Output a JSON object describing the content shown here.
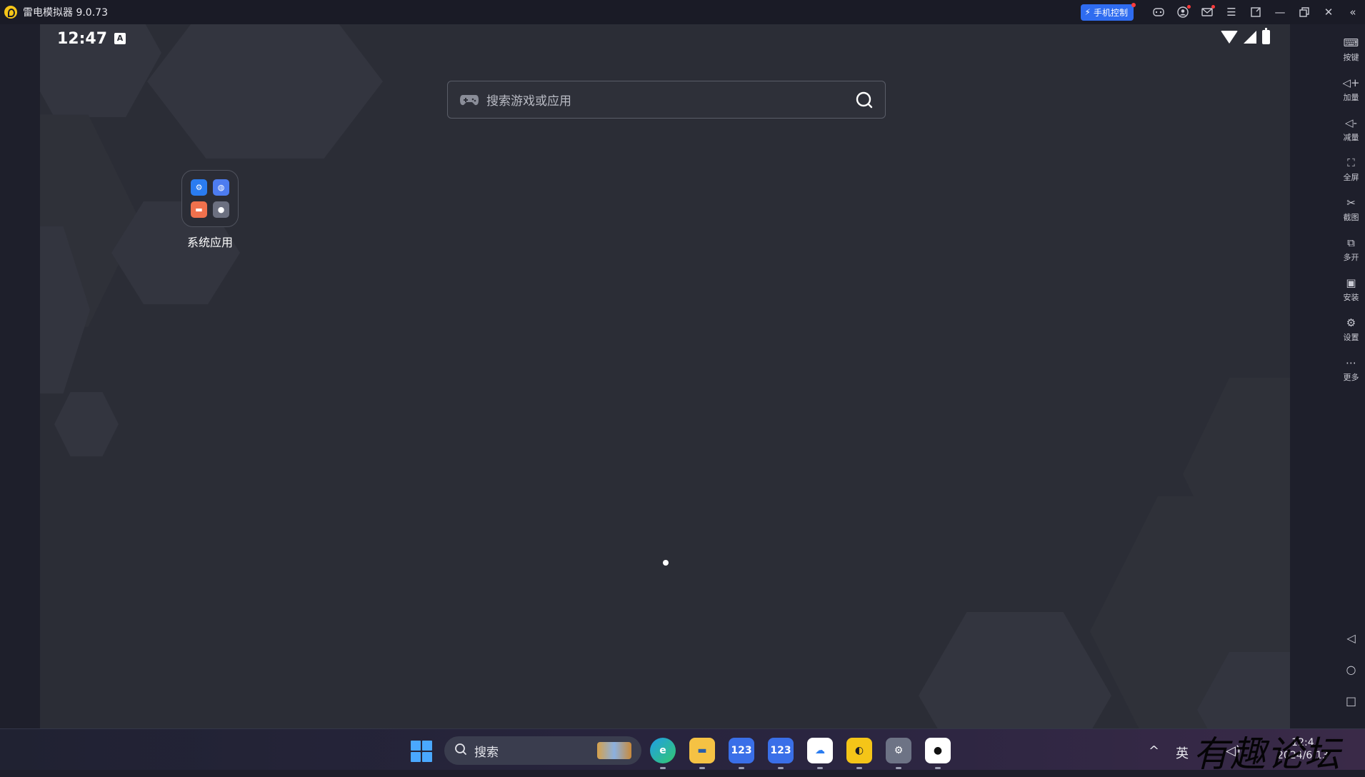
{
  "window": {
    "title": "雷电模拟器 9.0.73",
    "phone_control_label": "手机控制"
  },
  "status_bar": {
    "time": "12:47",
    "notification_letter": "A"
  },
  "search": {
    "placeholder": "搜索游戏或应用"
  },
  "folder": {
    "label": "系统应用"
  },
  "sidebar": {
    "items": [
      {
        "label": "按键",
        "icon": "keyboard-icon"
      },
      {
        "label": "加量",
        "icon": "volume-up-icon"
      },
      {
        "label": "减量",
        "icon": "volume-down-icon"
      },
      {
        "label": "全屏",
        "icon": "fullscreen-icon"
      },
      {
        "label": "截图",
        "icon": "scissors-icon"
      },
      {
        "label": "多开",
        "icon": "multi-window-icon"
      },
      {
        "label": "安装",
        "icon": "apk-icon"
      },
      {
        "label": "设置",
        "icon": "gear-icon"
      },
      {
        "label": "更多",
        "icon": "more-icon"
      }
    ]
  },
  "taskbar": {
    "search_placeholder": "搜索",
    "apps": [
      {
        "name": "edge",
        "icon": "edge-icon",
        "color": "#1f9ee8"
      },
      {
        "name": "file-explorer",
        "icon": "folder-icon",
        "color": "#f5c244"
      },
      {
        "name": "123pan-1",
        "icon": "123-icon",
        "glyph": "123",
        "color": "#3a6fe8"
      },
      {
        "name": "123pan-2",
        "icon": "123-icon",
        "glyph": "123",
        "color": "#3a6fe8"
      },
      {
        "name": "cloud-app",
        "icon": "cloud-icon",
        "color": "#ffffff"
      },
      {
        "name": "ldplayer",
        "icon": "ldplayer-icon",
        "color": "#f5c518"
      },
      {
        "name": "settings",
        "icon": "gear-icon",
        "color": "#6d7385"
      },
      {
        "name": "qq",
        "icon": "qq-penguin-icon",
        "color": "#ffffff"
      }
    ],
    "ime_label": "英",
    "clock_time": "12:4",
    "clock_date": "2024/6/13"
  },
  "watermark": "有趣论坛",
  "colors": {
    "accent": "#2f6cf0",
    "screen_bg": "#2b2d36"
  }
}
